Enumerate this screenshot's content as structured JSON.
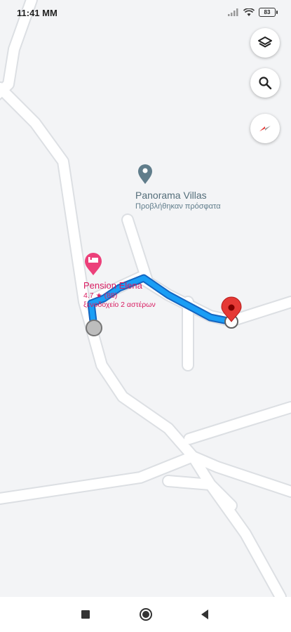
{
  "status_bar": {
    "time": "11:41 MM",
    "battery": "83"
  },
  "map": {
    "poi_panorama": {
      "name": "Panorama Villas",
      "subtitle": "Προβλήθηκαν πρόσφατα",
      "icon": "map-pin-icon",
      "color": "#607d8b"
    },
    "poi_pension": {
      "name": "Pension Elena",
      "rating": "4.7",
      "reviews": "(88)",
      "category": "ξενοδοχείο 2 αστέρων",
      "icon": "hotel-bed-icon",
      "color": "#e91e63"
    },
    "route": {
      "color": "#1a9ef5",
      "border_color": "#1565c0",
      "origin_marker": "gray-circle",
      "destination_marker": "red-pin"
    }
  },
  "controls": {
    "layers_icon": "layers-icon",
    "search_icon": "search-icon",
    "compass_icon": "compass-icon"
  },
  "nav": {
    "recent_apps": "square-icon",
    "home": "circle-icon",
    "back": "triangle-back-icon"
  }
}
